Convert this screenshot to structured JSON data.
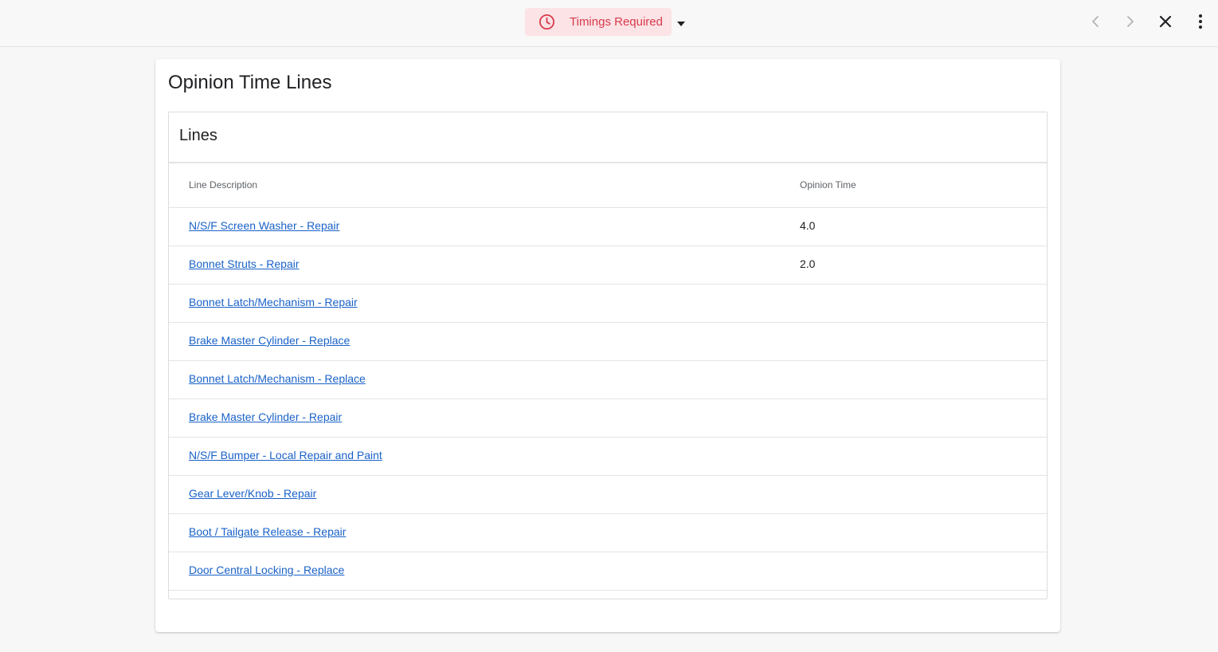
{
  "topbar": {
    "status_label": "Timings Required",
    "status_icon": "clock-icon",
    "status_color": "#d93a4b",
    "status_bg": "#fbe3e6",
    "icons": [
      "chevron-left-icon",
      "chevron-right-icon",
      "close-icon",
      "more-vert-icon"
    ]
  },
  "page": {
    "title": "Opinion Time Lines"
  },
  "lines_panel": {
    "title": "Lines",
    "columns": [
      "Line Description",
      "Opinion Time"
    ],
    "rows": [
      {
        "description": "N/S/F Screen Washer - Repair",
        "time": "4.0"
      },
      {
        "description": "Bonnet Struts - Repair",
        "time": "2.0"
      },
      {
        "description": "Bonnet Latch/Mechanism - Repair",
        "time": ""
      },
      {
        "description": "Brake Master Cylinder - Replace",
        "time": ""
      },
      {
        "description": "Bonnet Latch/Mechanism - Replace",
        "time": ""
      },
      {
        "description": "Brake Master Cylinder - Repair",
        "time": ""
      },
      {
        "description": "N/S/F Bumper - Local Repair and Paint",
        "time": ""
      },
      {
        "description": "Gear Lever/Knob - Repair",
        "time": ""
      },
      {
        "description": "Boot / Tailgate Release - Repair",
        "time": ""
      },
      {
        "description": "Door Central Locking - Replace",
        "time": ""
      }
    ]
  },
  "colors": {
    "link": "#1a62c8",
    "background": "#f7f7f7"
  }
}
